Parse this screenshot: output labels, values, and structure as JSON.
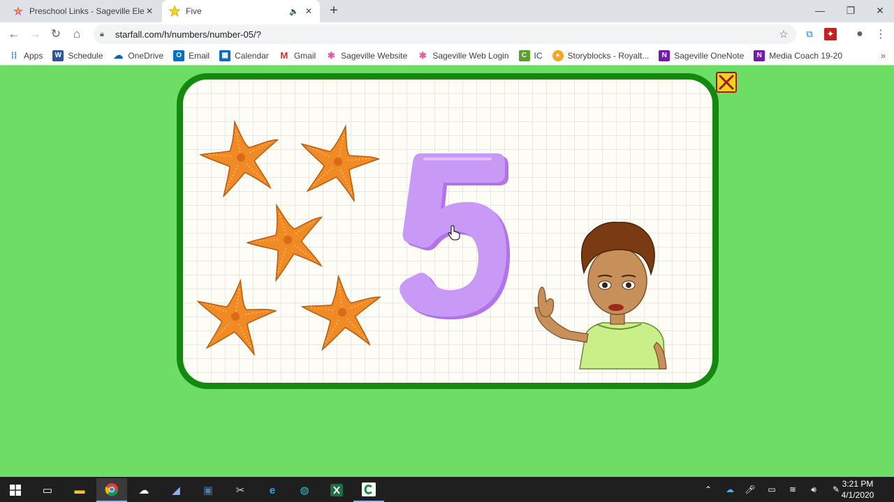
{
  "browser": {
    "tabs": [
      {
        "label": "Preschool Links - Sageville Eleme",
        "icon": "sageville-star-icon",
        "active": false
      },
      {
        "label": "Five",
        "icon": "starfall-star-icon",
        "active": true
      }
    ],
    "url": "starfall.com/h/numbers/number-05/?",
    "window_controls": [
      "minimize",
      "restore",
      "close"
    ]
  },
  "bookmarks": [
    {
      "label": "Apps",
      "icon": "apps-grid-icon",
      "color": "#1a73e8"
    },
    {
      "label": "Schedule",
      "icon": "word-icon",
      "color": "#2b579a"
    },
    {
      "label": "OneDrive",
      "icon": "onedrive-icon",
      "color": "#0364b8"
    },
    {
      "label": "Email",
      "icon": "outlook-icon",
      "color": "#0072c6"
    },
    {
      "label": "Calendar",
      "icon": "calendar-icon",
      "color": "#0f6cbd"
    },
    {
      "label": "Gmail",
      "icon": "gmail-icon",
      "color": "#d93025"
    },
    {
      "label": "Sageville Website",
      "icon": "sageville-star-icon",
      "color": "#f4b400"
    },
    {
      "label": "Sageville Web Login",
      "icon": "sageville-star-icon",
      "color": "#f4b400"
    },
    {
      "label": "IC",
      "icon": "ic-icon",
      "color": "#5aa02c"
    },
    {
      "label": "Storyblocks - Royalt...",
      "icon": "storyblocks-icon",
      "color": "#f5a623"
    },
    {
      "label": "Sageville OneNote",
      "icon": "onenote-icon",
      "color": "#7719aa"
    },
    {
      "label": "Media Coach 19-20",
      "icon": "onenote-icon",
      "color": "#7719aa"
    }
  ],
  "page": {
    "number": "5",
    "number_color": "#c08cf2",
    "starfish_count": 5,
    "background_color": "#6ddd66",
    "frame_color": "#138a0f"
  },
  "taskbar": {
    "apps": [
      "windows-start-icon",
      "task-view-icon",
      "file-explorer-icon",
      "chrome-icon",
      "onedrive-icon",
      "app-icon",
      "teamviewer-icon",
      "snipping-tool-icon",
      "internet-explorer-icon",
      "edge-icon",
      "excel-icon",
      "camtasia-icon"
    ],
    "time": "3:21 PM",
    "date": "4/1/2020"
  }
}
